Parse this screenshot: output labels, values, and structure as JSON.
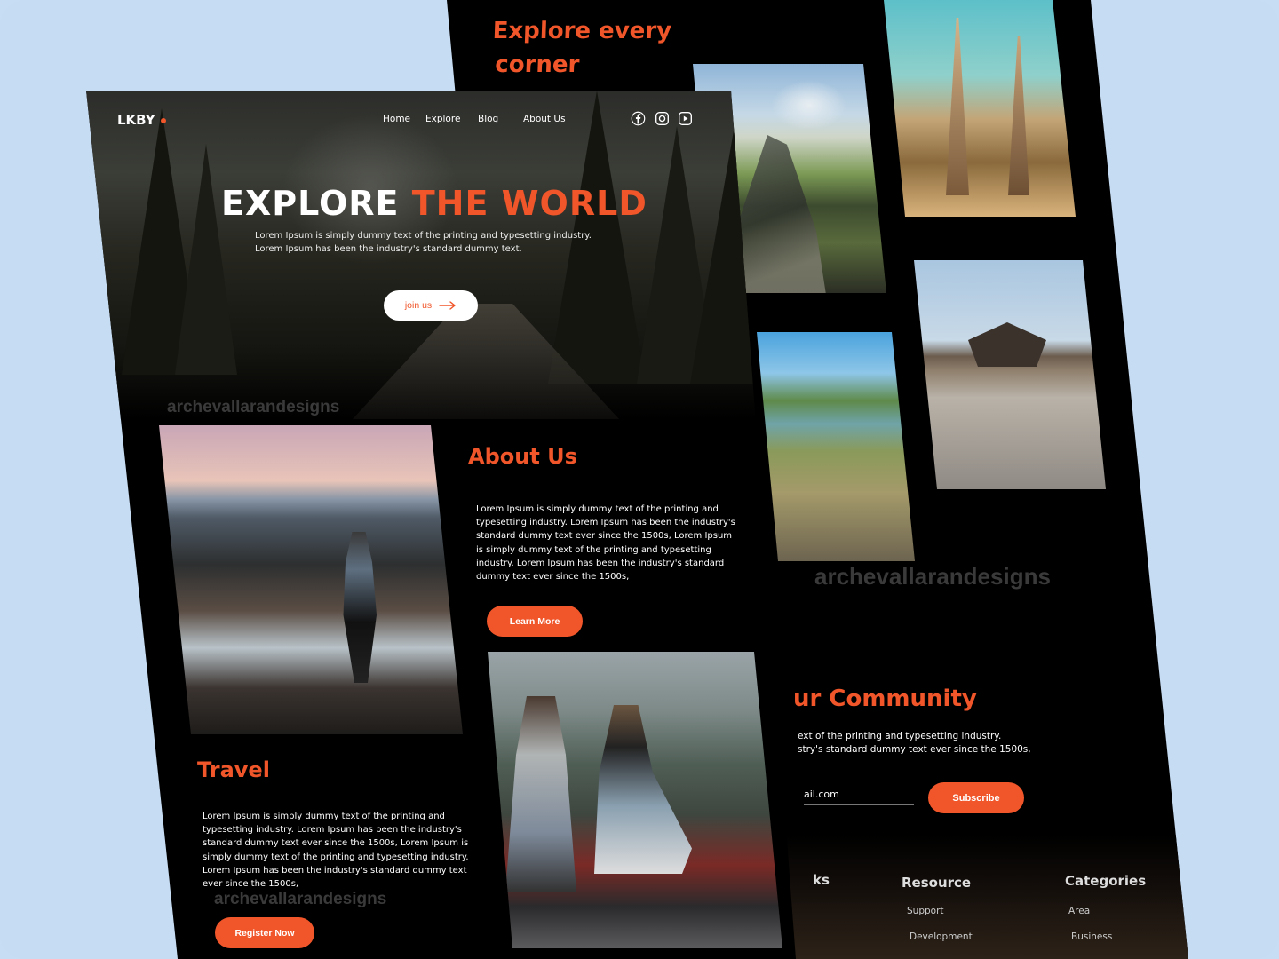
{
  "back_page": {
    "explore_heading_line1": "Explore every",
    "explore_heading_line2": "corner",
    "watermark": "archevallarandesigns",
    "community": {
      "title": "ur Community",
      "text_line1": "ext of the printing and typesetting industry.",
      "text_line2": "stry's standard dummy text ever since the 1500s,",
      "email_value": "ail.com",
      "subscribe_label": "Subscribe"
    },
    "footer": {
      "links_heading": "ks",
      "resource_heading": "Resource",
      "categories_heading": "Categories",
      "resource_items": [
        "Support",
        "Development"
      ],
      "category_items": [
        "Area",
        "Business"
      ]
    }
  },
  "front_page": {
    "logo": "LKBY",
    "nav": [
      "Home",
      "Explore",
      "Blog",
      "About Us"
    ],
    "social_icons": [
      "facebook-icon",
      "instagram-icon",
      "youtube-icon"
    ],
    "hero": {
      "title_white": "EXPLORE ",
      "title_orange": "THE WORLD",
      "subtitle_line1": "Lorem Ipsum is simply dummy text of the printing and typesetting industry.",
      "subtitle_line2": "Lorem Ipsum has been the industry's standard dummy text.",
      "join_label": "join us"
    },
    "watermark": "archevallarandesigns",
    "about": {
      "title": "About Us",
      "text": "Lorem Ipsum is simply dummy text of the printing and typesetting industry. Lorem Ipsum has been the industry's standard dummy text ever since the 1500s, Lorem Ipsum is simply dummy text of the printing and typesetting industry. Lorem Ipsum has been the industry's standard dummy text ever since the 1500s,",
      "button_label": "Learn More"
    },
    "travel": {
      "title": "Travel",
      "text": "Lorem Ipsum is simply dummy text of the printing and typesetting industry. Lorem Ipsum has been the industry's standard dummy text ever since the 1500s, Lorem Ipsum is simply dummy text of the printing and typesetting industry. Lorem Ipsum has been the industry's standard dummy text ever since the 1500s,",
      "button_label": "Register Now"
    }
  },
  "colors": {
    "accent": "#f0562a",
    "background": "#c7ddf3",
    "page": "#000000"
  }
}
